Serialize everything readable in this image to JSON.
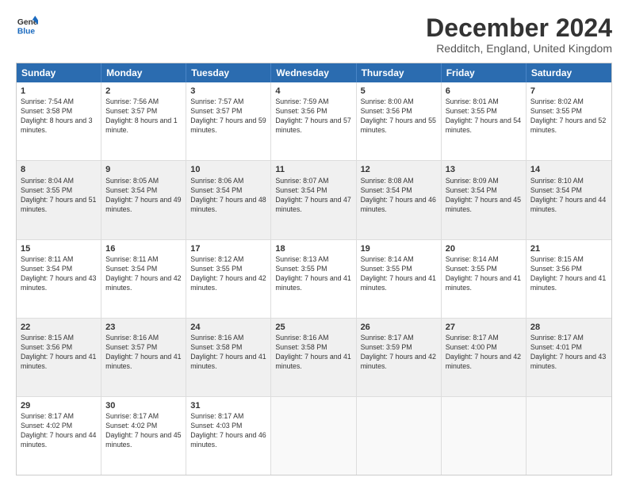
{
  "header": {
    "logo_line1": "General",
    "logo_line2": "Blue",
    "month_title": "December 2024",
    "location": "Redditch, England, United Kingdom"
  },
  "weekdays": [
    "Sunday",
    "Monday",
    "Tuesday",
    "Wednesday",
    "Thursday",
    "Friday",
    "Saturday"
  ],
  "weeks": [
    [
      {
        "day": "1",
        "sunrise": "7:54 AM",
        "sunset": "3:58 PM",
        "daylight": "8 hours and 3 minutes."
      },
      {
        "day": "2",
        "sunrise": "7:56 AM",
        "sunset": "3:57 PM",
        "daylight": "8 hours and 1 minute."
      },
      {
        "day": "3",
        "sunrise": "7:57 AM",
        "sunset": "3:57 PM",
        "daylight": "7 hours and 59 minutes."
      },
      {
        "day": "4",
        "sunrise": "7:59 AM",
        "sunset": "3:56 PM",
        "daylight": "7 hours and 57 minutes."
      },
      {
        "day": "5",
        "sunrise": "8:00 AM",
        "sunset": "3:56 PM",
        "daylight": "7 hours and 55 minutes."
      },
      {
        "day": "6",
        "sunrise": "8:01 AM",
        "sunset": "3:55 PM",
        "daylight": "7 hours and 54 minutes."
      },
      {
        "day": "7",
        "sunrise": "8:02 AM",
        "sunset": "3:55 PM",
        "daylight": "7 hours and 52 minutes."
      }
    ],
    [
      {
        "day": "8",
        "sunrise": "8:04 AM",
        "sunset": "3:55 PM",
        "daylight": "7 hours and 51 minutes."
      },
      {
        "day": "9",
        "sunrise": "8:05 AM",
        "sunset": "3:54 PM",
        "daylight": "7 hours and 49 minutes."
      },
      {
        "day": "10",
        "sunrise": "8:06 AM",
        "sunset": "3:54 PM",
        "daylight": "7 hours and 48 minutes."
      },
      {
        "day": "11",
        "sunrise": "8:07 AM",
        "sunset": "3:54 PM",
        "daylight": "7 hours and 47 minutes."
      },
      {
        "day": "12",
        "sunrise": "8:08 AM",
        "sunset": "3:54 PM",
        "daylight": "7 hours and 46 minutes."
      },
      {
        "day": "13",
        "sunrise": "8:09 AM",
        "sunset": "3:54 PM",
        "daylight": "7 hours and 45 minutes."
      },
      {
        "day": "14",
        "sunrise": "8:10 AM",
        "sunset": "3:54 PM",
        "daylight": "7 hours and 44 minutes."
      }
    ],
    [
      {
        "day": "15",
        "sunrise": "8:11 AM",
        "sunset": "3:54 PM",
        "daylight": "7 hours and 43 minutes."
      },
      {
        "day": "16",
        "sunrise": "8:11 AM",
        "sunset": "3:54 PM",
        "daylight": "7 hours and 42 minutes."
      },
      {
        "day": "17",
        "sunrise": "8:12 AM",
        "sunset": "3:55 PM",
        "daylight": "7 hours and 42 minutes."
      },
      {
        "day": "18",
        "sunrise": "8:13 AM",
        "sunset": "3:55 PM",
        "daylight": "7 hours and 41 minutes."
      },
      {
        "day": "19",
        "sunrise": "8:14 AM",
        "sunset": "3:55 PM",
        "daylight": "7 hours and 41 minutes."
      },
      {
        "day": "20",
        "sunrise": "8:14 AM",
        "sunset": "3:55 PM",
        "daylight": "7 hours and 41 minutes."
      },
      {
        "day": "21",
        "sunrise": "8:15 AM",
        "sunset": "3:56 PM",
        "daylight": "7 hours and 41 minutes."
      }
    ],
    [
      {
        "day": "22",
        "sunrise": "8:15 AM",
        "sunset": "3:56 PM",
        "daylight": "7 hours and 41 minutes."
      },
      {
        "day": "23",
        "sunrise": "8:16 AM",
        "sunset": "3:57 PM",
        "daylight": "7 hours and 41 minutes."
      },
      {
        "day": "24",
        "sunrise": "8:16 AM",
        "sunset": "3:58 PM",
        "daylight": "7 hours and 41 minutes."
      },
      {
        "day": "25",
        "sunrise": "8:16 AM",
        "sunset": "3:58 PM",
        "daylight": "7 hours and 41 minutes."
      },
      {
        "day": "26",
        "sunrise": "8:17 AM",
        "sunset": "3:59 PM",
        "daylight": "7 hours and 42 minutes."
      },
      {
        "day": "27",
        "sunrise": "8:17 AM",
        "sunset": "4:00 PM",
        "daylight": "7 hours and 42 minutes."
      },
      {
        "day": "28",
        "sunrise": "8:17 AM",
        "sunset": "4:01 PM",
        "daylight": "7 hours and 43 minutes."
      }
    ],
    [
      {
        "day": "29",
        "sunrise": "8:17 AM",
        "sunset": "4:02 PM",
        "daylight": "7 hours and 44 minutes."
      },
      {
        "day": "30",
        "sunrise": "8:17 AM",
        "sunset": "4:02 PM",
        "daylight": "7 hours and 45 minutes."
      },
      {
        "day": "31",
        "sunrise": "8:17 AM",
        "sunset": "4:03 PM",
        "daylight": "7 hours and 46 minutes."
      },
      null,
      null,
      null,
      null
    ]
  ]
}
